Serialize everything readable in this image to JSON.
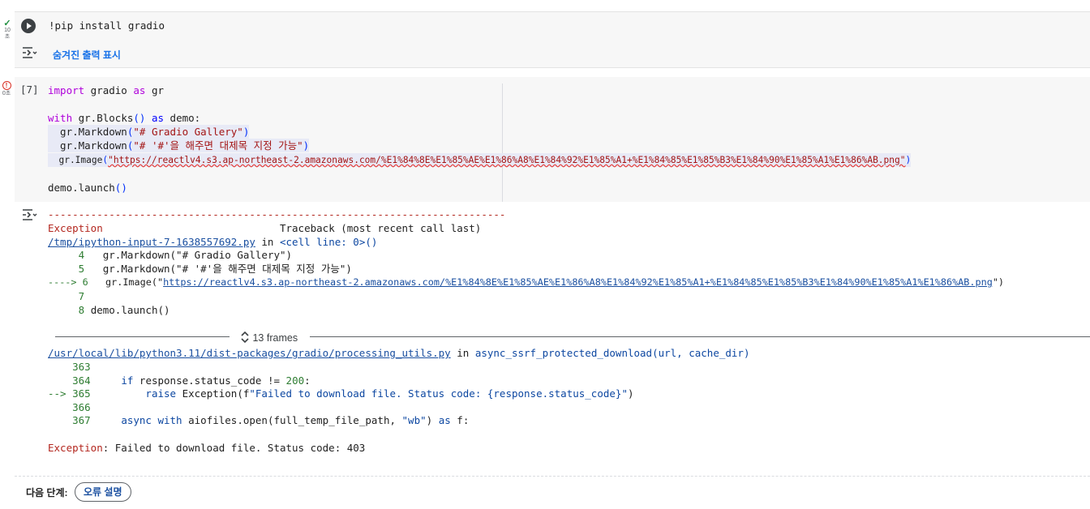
{
  "cell1": {
    "status_check": "✓",
    "status_time": "10\n초",
    "code": "!pip install gradio",
    "show_hidden_label": "숨겨진 출력 표시"
  },
  "cell2": {
    "status_time": "0초",
    "exec_count": "[7]",
    "code_lines": [
      "import gradio as gr",
      "",
      "with gr.Blocks() as demo:",
      "  gr.Markdown(\"# Gradio Gallery\")",
      "  gr.Markdown(\"# '#'을 해주면 대제목 지정 가능\")",
      "  gr.Image(\"https://reactlv4.s3.ap-northeast-2.amazonaws.com/%E1%84%8E%E1%85%AE%E1%86%A8%E1%84%92%E1%85%A1+%E1%84%85%E1%85%B3%E1%84%90%E1%85%A1%E1%86%AB.png\")",
      "",
      "demo.launch()"
    ]
  },
  "output": {
    "dashes": "---------------------------------------------------------------------------",
    "exception_header": "Exception",
    "traceback_header": "Traceback (most recent call last)",
    "file1": "/tmp/ipython-input-7-1638557692.py",
    "in_word": "in",
    "cell_line": "<cell line: 0>()",
    "tb1": [
      {
        "marker": "",
        "num": "4",
        "code": "gr.Markdown(\"# Gradio Gallery\")"
      },
      {
        "marker": "",
        "num": "5",
        "code": "gr.Markdown(\"# '#'을 해주면 대제목 지정 가능\")"
      },
      {
        "marker": "---->",
        "num": "6",
        "code_pre": "gr.Image(\"",
        "url": "https://reactlv4.s3.ap-northeast-2.amazonaws.com/%E1%84%8E%E1%85%AE%E1%86%A8%E1%84%92%E1%85%A1+%E1%84%85%E1%85%B3%E1%84%90%E1%85%A1%E1%86%AB.png",
        "code_post": "\")"
      },
      {
        "marker": "",
        "num": "7",
        "code": ""
      },
      {
        "marker": "",
        "num": "8",
        "code": "demo.launch()"
      }
    ],
    "frames_label": "13 frames",
    "file2": "/usr/local/lib/python3.11/dist-packages/gradio/processing_utils.py",
    "func2": "async_ssrf_protected_download(url, cache_dir)",
    "tb2": [
      {
        "marker": "",
        "num": "363",
        "code": ""
      },
      {
        "marker": "",
        "num": "364",
        "code": "    if response.status_code != 200:"
      },
      {
        "marker": "-->",
        "num": "365",
        "code": "        raise Exception(f\"Failed to download file. Status code: {response.status_code}\")"
      },
      {
        "marker": "",
        "num": "366",
        "code": ""
      },
      {
        "marker": "",
        "num": "367",
        "code": "    async with aiofiles.open(full_temp_file_path, \"wb\") as f:"
      }
    ],
    "final_exc_name": "Exception",
    "final_exc_msg": ": Failed to download file. Status code: 403"
  },
  "footer": {
    "next_steps_label": "다음 단계:",
    "explain_error_label": "오류 설명"
  }
}
